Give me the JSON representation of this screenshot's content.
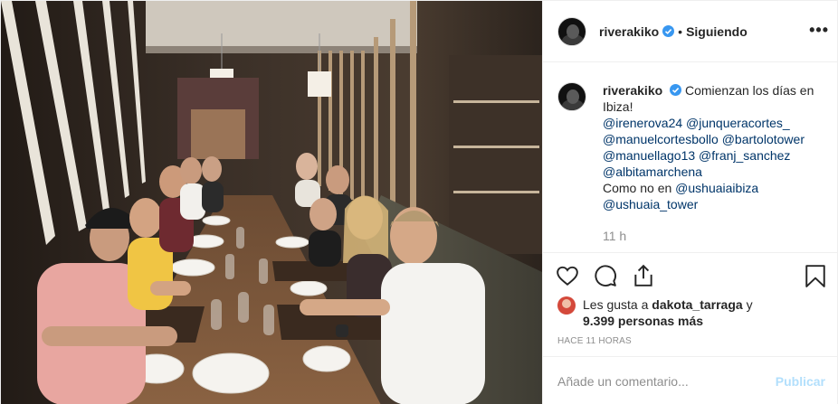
{
  "post": {
    "photo": {
      "description_name": "restaurant-group-photo"
    },
    "header": {
      "username": "riverakiko",
      "separator": "•",
      "follow_status": "Siguiendo",
      "more_label": "•••"
    },
    "caption": {
      "username": "riverakiko",
      "text": "Comienzan los días en Ibiza!",
      "mentions": [
        "@irenerova24 @junqueracortes_",
        "@manuelcortesbollo @bartolotower",
        "@manuellago13 @franj_sanchez",
        "@albitamarchena"
      ],
      "closing_text": "Como no en",
      "closing_mention": "@ushuaiaibiza",
      "final_mention": "@ushuaia_tower",
      "time_ago": "11 h"
    },
    "likes": {
      "prefix": "Les gusta a",
      "first_user": "dakota_tarraga",
      "joiner": "y",
      "count": "9.399 personas más"
    },
    "posted_ago": "HACE 11 HORAS",
    "comment": {
      "placeholder": "Añade un comentario...",
      "submit_label": "Publicar"
    },
    "colors": {
      "link": "#003569",
      "verified": "#3897f0",
      "muted": "#8e8e8e",
      "publish_disabled": "#b2dffc"
    },
    "icons": [
      "heart-icon",
      "comment-icon",
      "share-icon",
      "bookmark-icon",
      "verified-badge-icon",
      "more-options-icon"
    ]
  }
}
